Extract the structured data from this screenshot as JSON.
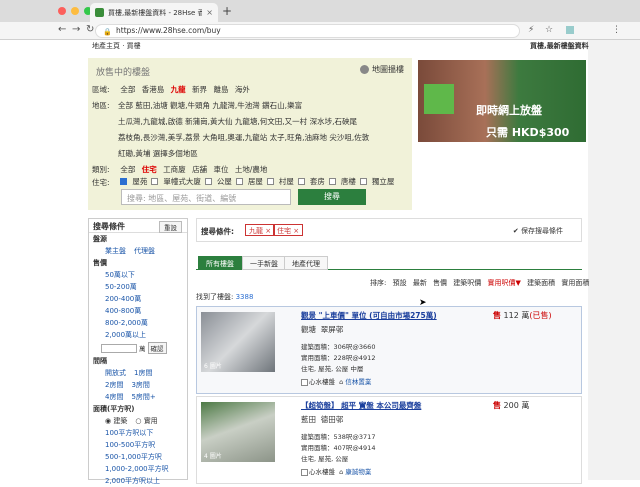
{
  "browser": {
    "tab_title": "買樓,最新樓盤資料 - 28Hse 香港",
    "tab_close": "×",
    "new_tab": "+",
    "url": "https://www.28hse.com/buy",
    "back": "←",
    "forward": "→",
    "reload": "↻",
    "ext1": "⚡",
    "star": "☆",
    "menu": "⋮"
  },
  "page": {
    "breadcrumb": "地產主頁 · 買樓",
    "site_title": "買樓,最新樓盤資料"
  },
  "filter": {
    "heading": "放售中的樓盤",
    "map_link": "地圖搵樓",
    "region_label": "區域:",
    "regions": [
      "全部",
      "香港島",
      "九龍",
      "新界",
      "離島",
      "海外"
    ],
    "district_label": "地區:",
    "district_lines": [
      "全部 藍田,油塘 觀塘,牛頭角 九龍灣,牛池灣 鑽石山,樂富",
      "土瓜灣,九龍城,啟德 新蒲崗,黃大仙 九龍塘,何文田,又一村 深水埗,石硤尾",
      "荔枝角,長沙灣,美孚,荔景 大角咀,奧運,九龍站 太子,旺角,油麻地 尖沙咀,佐敦",
      "紅磡,黃埔 選擇多個地區"
    ],
    "type_label": "類別:",
    "types": [
      "全部",
      "住宅",
      "工商廈",
      "店舖",
      "車位",
      "土地/農地"
    ],
    "res_label": "住宅:",
    "res_types": [
      "屋苑",
      "單幢式大廈",
      "公屋",
      "居屋",
      "村屋",
      "套房",
      "唐樓",
      "獨立屋"
    ],
    "search_placeholder": "搜尋: 地區、屋苑、街道、編號",
    "search_button": "搜尋"
  },
  "banner": {
    "line1": "即時網上放盤",
    "line2": "只需 HKD$300"
  },
  "leftpanel": {
    "title": "搜尋條件",
    "reset": "重設",
    "sec_source": "盤源",
    "source_items": [
      "業主盤",
      "代理盤"
    ],
    "sec_price": "售價",
    "price_items": [
      "50萬以下",
      "50-200萬",
      "200-400萬",
      "400-800萬",
      "800-2,000萬",
      "2,000萬以上"
    ],
    "price_unit": "萬",
    "confirm": "確認",
    "sec_rooms": "間隔",
    "room_items": [
      [
        "開放式",
        "1房間"
      ],
      [
        "2房間",
        "3房間"
      ],
      [
        "4房間",
        "5房間+"
      ]
    ],
    "sec_area": "面積(平方呎)",
    "area_opts": [
      "建築",
      "實用"
    ],
    "area_items": [
      "100平方呎以下",
      "100-500平方呎",
      "500-1,000平方呎",
      "1,000-2,000平方呎",
      "2,000平方呎以上"
    ]
  },
  "criteria": {
    "title": "搜尋條件:",
    "tags": [
      "九龍 ×",
      "住宅 ×"
    ],
    "save": "✔ 保存搜尋條件"
  },
  "tabs": [
    "所有樓盤",
    "一手新盤",
    "地產代理"
  ],
  "sort": {
    "label": "排序:",
    "options": [
      "預設",
      "最新",
      "售價",
      "建築呎價",
      "實用呎價▼",
      "建築面積",
      "實用面積"
    ]
  },
  "found": {
    "label": "找到了樓盤:",
    "count": "3388"
  },
  "listings": [
    {
      "title": "觀景 \"上車價\" 單位 (可自由市場275萬)",
      "district": "觀塘",
      "estate": "翠屏邨",
      "gross": "建築面積：306呎@3660",
      "saleable": "實用面積：228呎@4912",
      "tags": "住宅, 屋苑, 公屋 中層",
      "agent_check": "心水樓盤",
      "agent": "信林置業",
      "photos": "6 圖片",
      "sell": "售",
      "price": "112 萬",
      "status": "(已售)"
    },
    {
      "title": "【超筍盤】 超平 實盤 本公司最齊盤",
      "district": "藍田",
      "estate": "德田邨",
      "gross": "建築面積：538呎@3717",
      "saleable": "實用面積：407呎@4914",
      "tags": "住宅, 屋苑, 公屋",
      "agent_check": "心水樓盤",
      "agent": "康誠物業",
      "photos": "4 圖片",
      "sell": "售",
      "price": "200 萬",
      "status": ""
    }
  ],
  "colors": {
    "brand_green": "#2c7f3e",
    "filter_bg": "#f1f2d9",
    "active_red": "#dd0000"
  },
  "icons": {
    "map": "map-pin-icon",
    "lock": "lock-icon"
  }
}
